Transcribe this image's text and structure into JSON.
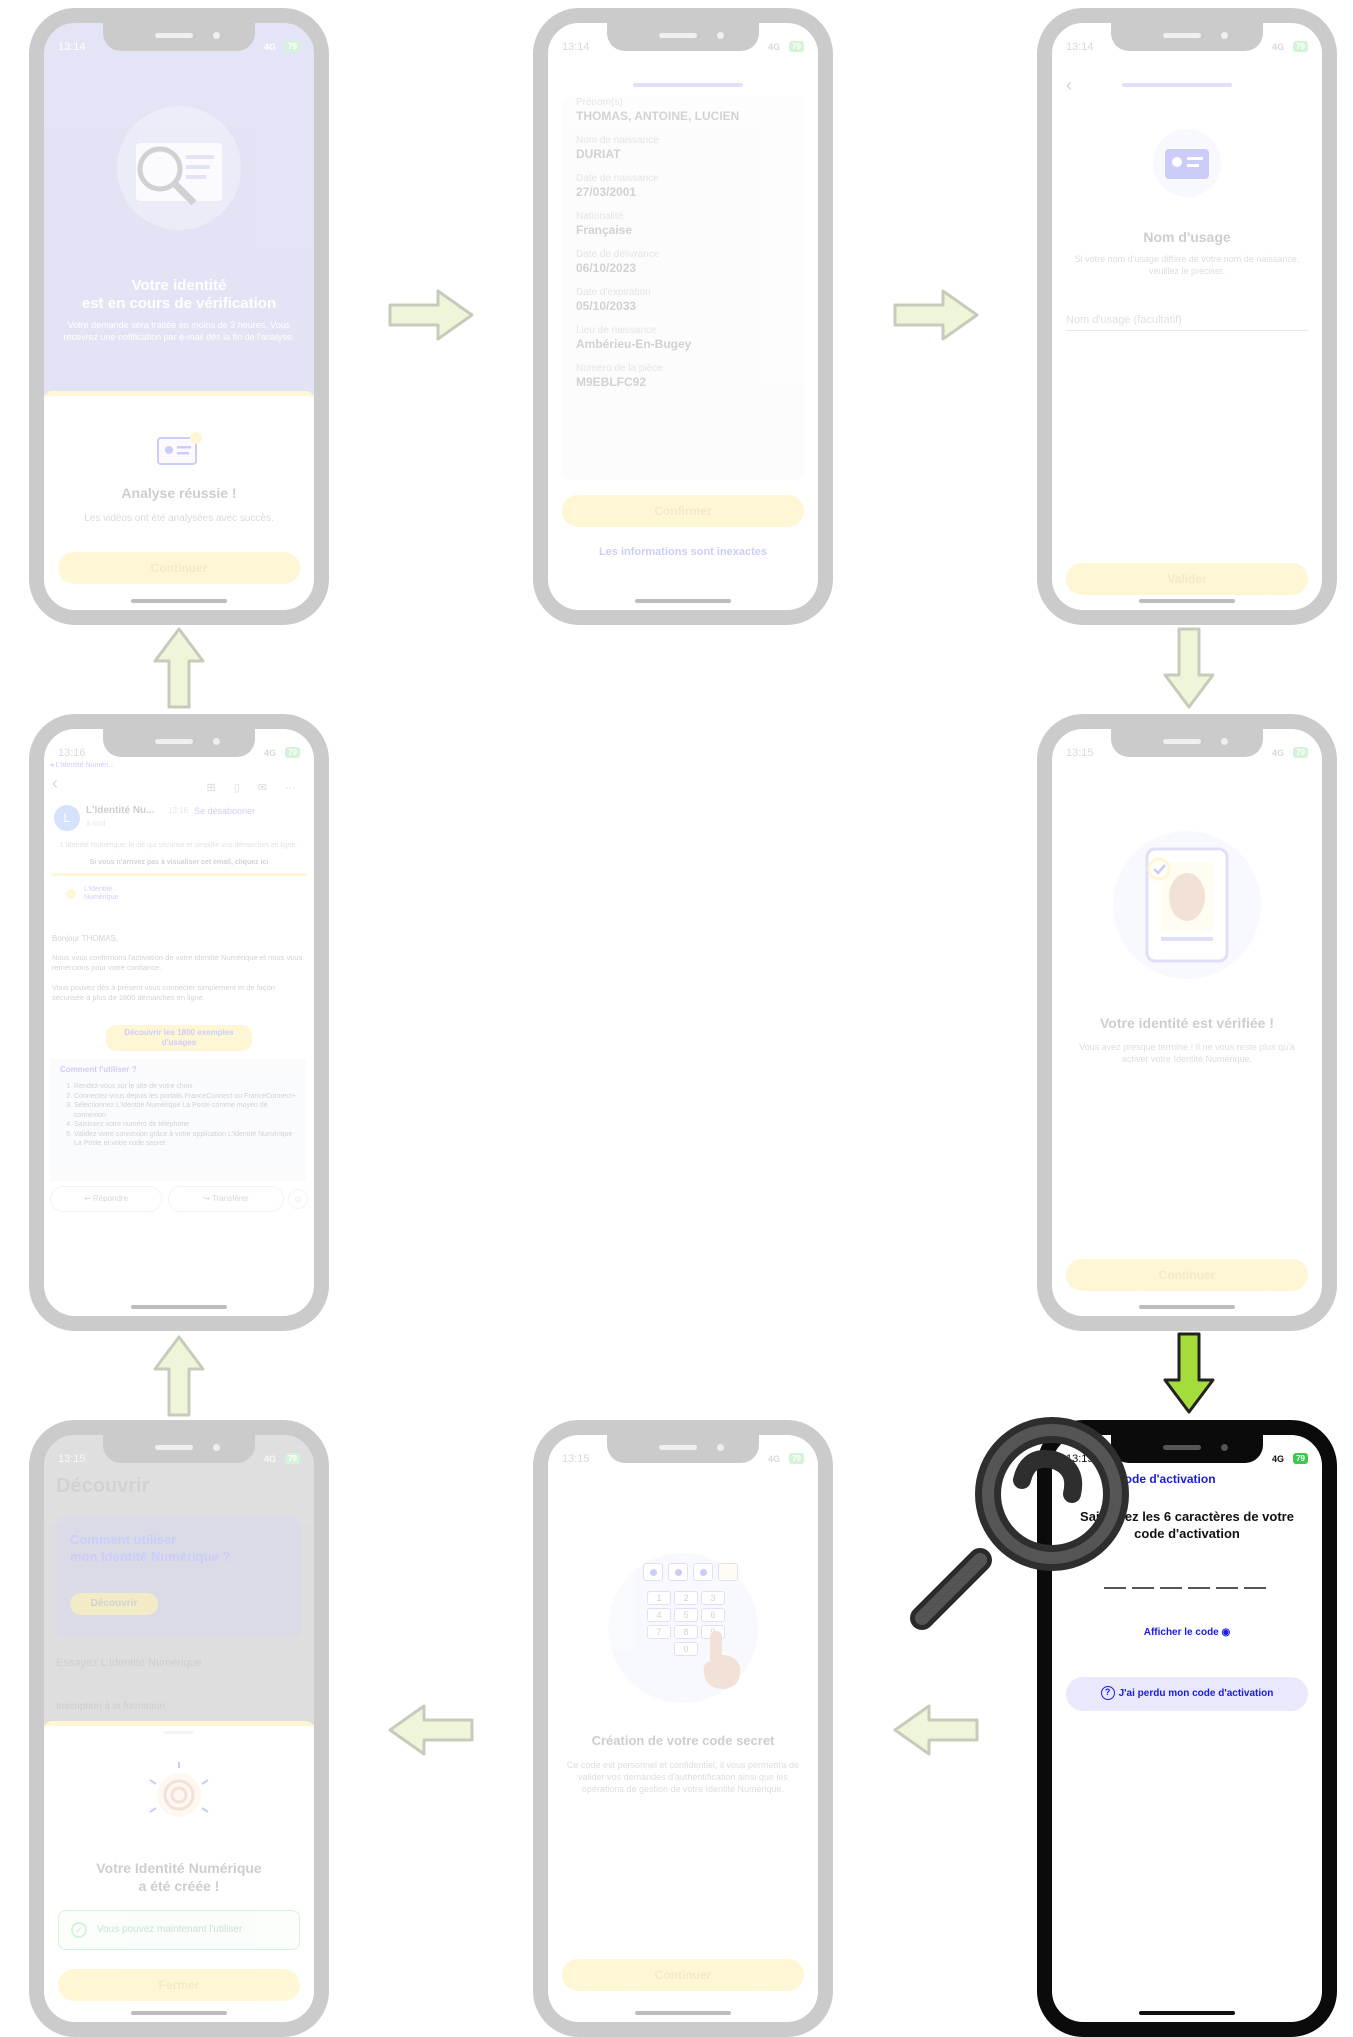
{
  "colors": {
    "yellow": "#fed843",
    "blue": "#1a1ae6",
    "lavender": "#ece9fb",
    "green_arrow": "#a4dd3b",
    "pale_arrow": "#e6f1c7"
  },
  "phone1": {
    "status": {
      "time": "13:14",
      "network": "4G",
      "battery": "79"
    },
    "title_line1": "Votre identité",
    "title_line2": "est en cours de vérification",
    "body": "Votre demande sera traitée en moins de 3 heures. Vous recevrez une notification par e-mail dès la fin de l'analyse.",
    "sheet_title": "Analyse réussie !",
    "sheet_text": "Les vidéos ont été analysées avec succès.",
    "button": "Continuer"
  },
  "phone2": {
    "status": {
      "time": "13:14",
      "network": "4G",
      "battery": "79"
    },
    "fields": [
      {
        "label": "Prénom(s)",
        "value": "THOMAS, ANTOINE, LUCIEN"
      },
      {
        "label": "Nom de naissance",
        "value": "DURIAT"
      },
      {
        "label": "Date de naissance",
        "value": "27/03/2001"
      },
      {
        "label": "Nationalité",
        "value": "Française"
      },
      {
        "label": "Date de délivrance",
        "value": "06/10/2023"
      },
      {
        "label": "Date d'expiration",
        "value": "05/10/2033"
      },
      {
        "label": "Lieu de naissance",
        "value": "Ambérieu-En-Bugey"
      },
      {
        "label": "Numéro de la pièce",
        "value": "M9EBLFC92"
      }
    ],
    "confirm": "Confirmer",
    "wrong": "Les informations sont inexactes"
  },
  "phone3": {
    "status": {
      "time": "13:14",
      "network": "4G",
      "battery": "79"
    },
    "title": "Nom d'usage",
    "text": "Si votre nom d'usage diffère de votre nom de naissance, veuillez le préciser.",
    "placeholder": "Nom d'usage (facultatif)",
    "button": "Valider"
  },
  "phone4": {
    "status": {
      "time": "13:16",
      "network": "4G",
      "battery": "79"
    },
    "back_app": "◂ L'Identité Numéri...",
    "sender": "L'Identité Nu...",
    "sender_time": "13:16",
    "to": "à moi",
    "unsubscribe": "Se désabonner",
    "avatar": "L",
    "intro": "L'Identité Numérique, le clé qui sécurise et simplifie vos démarches en ligne.",
    "view_online": "Si vous n'arrivez pas à visualiser cet email, cliquez ici",
    "logo_line1": "L'Identité",
    "logo_line2": "Numérique",
    "greeting": "Bonjour THOMAS,",
    "p1": "Nous vous confirmons l'activation de votre Identité Numérique et nous vous remercions pour votre confiance.",
    "p2": "Vous pouvez dès à présent vous connecter simplement et de façon sécurisée à plus de 1800 démarches en ligne.",
    "cta": "Découvrir les 1800 exemples d'usages",
    "how_title": "Comment l'utiliser ?",
    "steps": [
      "Rendez-vous sur le site de votre choix",
      "Connectez-vous depuis les portails FranceConnect ou FranceConnect+",
      "Sélectionnez L'Identité Numérique La Poste comme moyen de connexion",
      "Saisissez votre numéro de téléphone",
      "Validez votre connexion grâce à votre application L'Identité Numérique La Poste et votre code secret"
    ],
    "reply": "Répondre",
    "forward": "Transférer"
  },
  "phone5": {
    "status": {
      "time": "13:15",
      "network": "4G",
      "battery": "79"
    },
    "title": "Votre identité est vérifiée !",
    "text": "Vous avez presque terminé ! Il ne vous reste plus qu'à activer votre Identité Numérique.",
    "button": "Continuer"
  },
  "phone6": {
    "status": {
      "time": "13:15",
      "network": "4G",
      "battery": "79"
    },
    "screen_title": "Découvrir",
    "card_title_l1": "Comment utiliser",
    "card_title_l2": "mon Identité Numérique ?",
    "card_button": "Découvrir",
    "section": "Essayez L'Identité Numérique",
    "row": "Inscription à la formation",
    "sheet_title_l1": "Votre Identité Numérique",
    "sheet_title_l2": "a été créée !",
    "info": "Vous pouvez maintenant l'utiliser",
    "button": "Fermer"
  },
  "phone7": {
    "status": {
      "time": "13:15",
      "network": "4G",
      "battery": "79"
    },
    "keypad": [
      "1",
      "2",
      "3",
      "4",
      "5",
      "6",
      "7",
      "8",
      "9",
      "0"
    ],
    "title": "Création de votre code secret",
    "text": "Ce code est personnel et confidentiel, il vous permettra de valider vos demandes d'authentification ainsi que les opérations de gestion de votre Identité Numérique.",
    "button": "Continuer"
  },
  "phone8": {
    "status": {
      "time": "13:15",
      "network": "4G",
      "battery": "79"
    },
    "header": "Code d'activation",
    "title_l1": "Saisissez les 6 caractères de votre",
    "title_l2": "code d'activation",
    "show_code": "Afficher le code",
    "lost_code": "J'ai perdu mon code d'activation"
  }
}
